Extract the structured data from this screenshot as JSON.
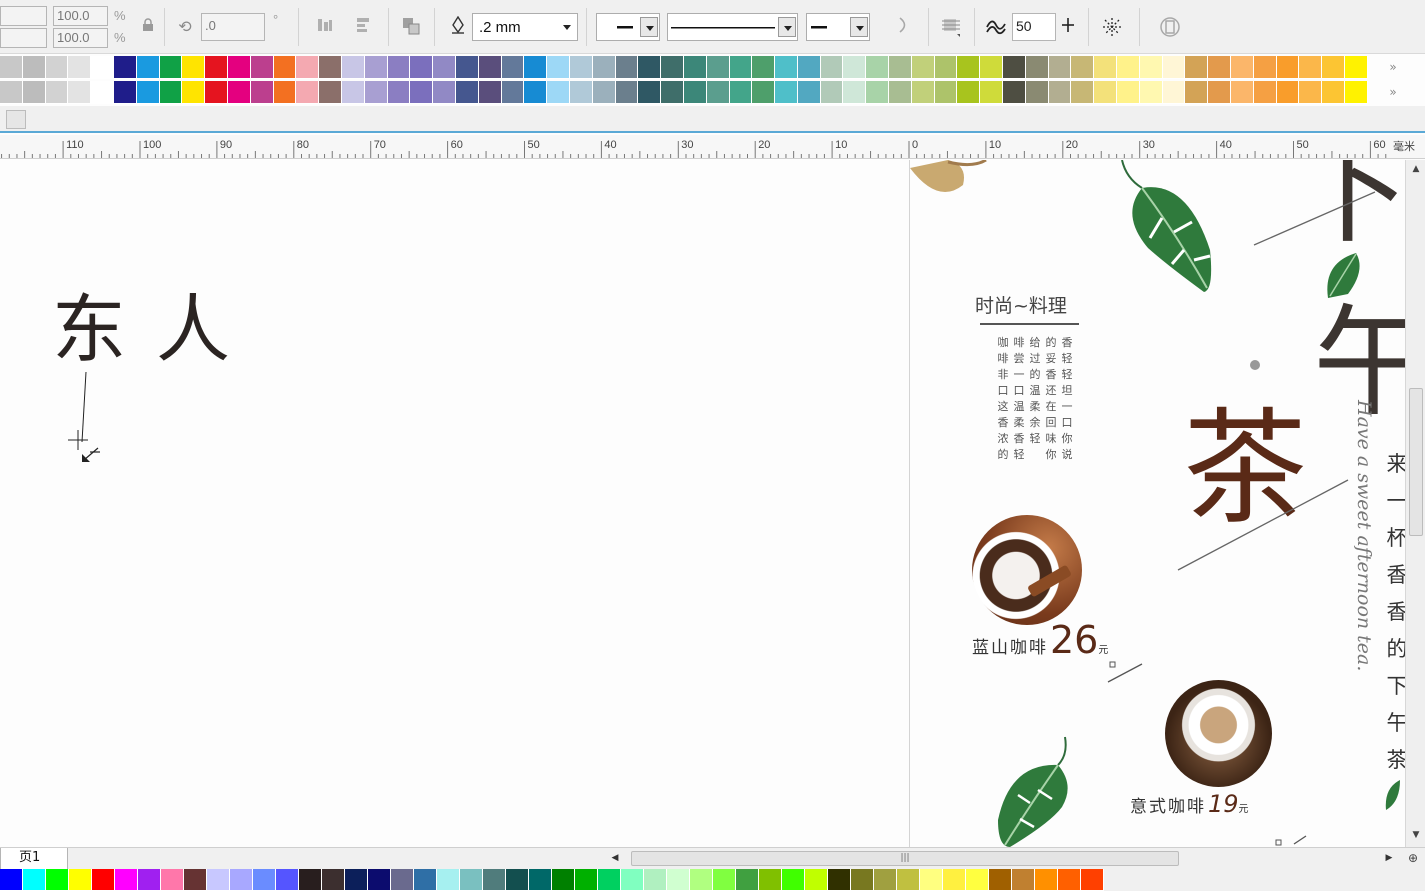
{
  "property_bar": {
    "scale_x": "100.0",
    "scale_y": "100.0",
    "percent_unit": "%",
    "rotation": ".0",
    "degree_unit": "°",
    "outline_width": ".2 mm",
    "smoothing": "50",
    "icons": [
      "lock-icon",
      "rotate-icon",
      "align-icon",
      "distribute-icon",
      "order-icon",
      "pen-icon",
      "line-start-icon",
      "line-style-icon",
      "line-end-icon",
      "close-curve-icon",
      "wrap-icon",
      "curve-icon",
      "add-node-icon",
      "nodes-icon",
      "scale-icon"
    ]
  },
  "palette_top": [
    "#c8c8c8",
    "#bcbcbc",
    "#d2d2d2",
    "#e3e3e3",
    "#ffffff",
    "#1f1d8a",
    "#1a9ae0",
    "#10a146",
    "#ffe400",
    "#e5141f",
    "#e4007f",
    "#bc3f8e",
    "#f37021",
    "#f4a9b1",
    "#8b6f6a",
    "#c8c6e6",
    "#a89fd2",
    "#8b7ec2",
    "#7b6fbd",
    "#9189c5",
    "#45578f",
    "#5a4e7c",
    "#63799a",
    "#178bd3",
    "#9dd8f6",
    "#b0c9d8",
    "#9bb0bc",
    "#6b7f8d",
    "#2f5864",
    "#3f6e6a",
    "#3c8779",
    "#5b9e8e",
    "#43a58a",
    "#4e9f6b",
    "#4fbfc9",
    "#52a8c1",
    "#b1cab8",
    "#cfe7d8",
    "#a8d3a8",
    "#a8bd92",
    "#c1d07a",
    "#adc36a",
    "#a8c41e",
    "#cfdb3a",
    "#4e4e42",
    "#8a8a72",
    "#b2ae91",
    "#c7b775",
    "#f3e17a",
    "#fff28a",
    "#fff8b0",
    "#fff6d6",
    "#d3a356",
    "#e39a4c",
    "#fbb66a",
    "#f5a043",
    "#f99d2b",
    "#fbb74a",
    "#fcc533",
    "#fff200"
  ],
  "palette_bottom": [
    "#0000ff",
    "#00ffff",
    "#00ff00",
    "#ffff00",
    "#ff0000",
    "#ff00ff",
    "#a020f0",
    "#ff77aa",
    "#663333",
    "#c8c8ff",
    "#a8a8ff",
    "#6a8cff",
    "#5555ff",
    "#281e1e",
    "#3c2f2f",
    "#0c1f5a",
    "#0c0c6e",
    "#6a6a8e",
    "#2f6fa6",
    "#a6f0f0",
    "#7ac0c0",
    "#507c7c",
    "#134f4f",
    "#006868",
    "#008000",
    "#00b000",
    "#00d060",
    "#80ffc0",
    "#b0f0c0",
    "#d0ffd0",
    "#b0ff80",
    "#80ff40",
    "#40a040",
    "#80c000",
    "#40ff00",
    "#c0ff00",
    "#303000",
    "#787820",
    "#a0a040",
    "#c0c040",
    "#ffff80",
    "#fff040",
    "#ffff40",
    "#a06000",
    "#c08030",
    "#ff9000",
    "#ff6000",
    "#ff4000"
  ],
  "ruler": {
    "labels": [
      "110",
      "100",
      "90",
      "80",
      "70",
      "60",
      "50",
      "40",
      "30",
      "20",
      "10",
      "0",
      "10",
      "20",
      "30",
      "40",
      "50",
      "60"
    ],
    "unit": "毫米"
  },
  "canvas": {
    "big_text": "东人",
    "fashion_heading": "时尚~料理",
    "poem_columns": [
      "咖啡非口这香浓的",
      "啡尝一口温柔香轻",
      "给过的温柔余轻",
      "的妥香还在回味你",
      "香轻轻坦一口你说"
    ],
    "tea_char": "茶",
    "wu_char": "午",
    "xia_char": "下",
    "script_line": "Have a sweet afternoon tea.",
    "item1_name": "蓝山咖啡",
    "item1_price": "26",
    "item1_unit": "元",
    "item2_name": "意式咖啡",
    "item2_price": "19",
    "item2_unit": "元",
    "side_chars": [
      "来",
      "一",
      "杯",
      "香",
      "香",
      "的",
      "下",
      "午",
      "茶"
    ]
  },
  "page_tab": "页1"
}
